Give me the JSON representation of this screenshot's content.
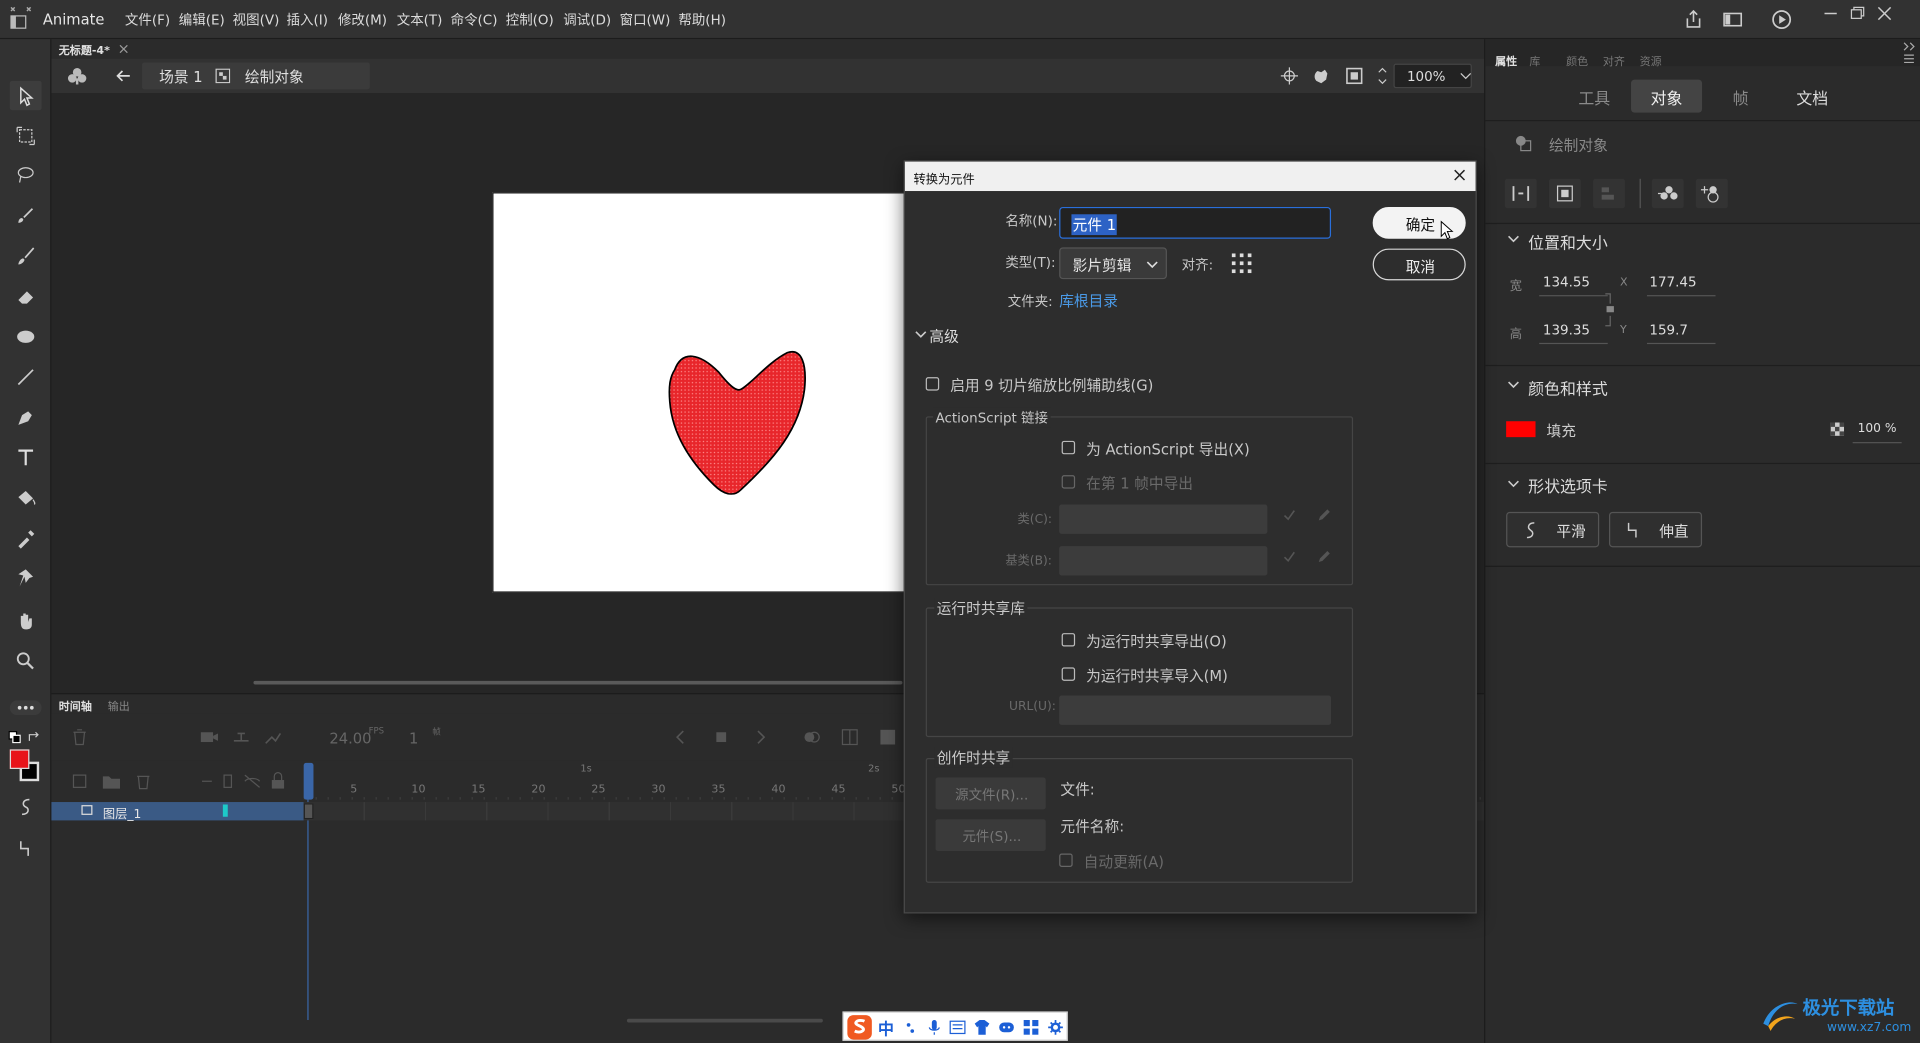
{
  "app": {
    "name": "Animate"
  },
  "menus": [
    "文件(F)",
    "编辑(E)",
    "视图(V)",
    "插入(I)",
    "修改(M)",
    "文本(T)",
    "命令(C)",
    "控制(O)",
    "调试(D)",
    "窗口(W)",
    "帮助(H)"
  ],
  "document": {
    "tab_title": "无标题-4*"
  },
  "editbar": {
    "scene": "场景 1",
    "object": "绘制对象",
    "zoom": "100%"
  },
  "timeline": {
    "tabs": [
      "时间轴",
      "输出"
    ],
    "fps": "24.00",
    "fps_unit": "FPS",
    "frame": "1",
    "frame_unit": "帧",
    "seconds": [
      "1s",
      "2s"
    ],
    "ruler": [
      "5",
      "10",
      "15",
      "20",
      "25",
      "30",
      "35",
      "40",
      "45",
      "50"
    ],
    "layer_name": "图层_1"
  },
  "rpanel": {
    "tabs": [
      "属性",
      "库",
      "颜色",
      "对齐",
      "资源"
    ],
    "subtabs": [
      "工具",
      "对象",
      "帧",
      "文档"
    ],
    "active_subtab": "对象",
    "object_type": "绘制对象",
    "position_section": "位置和大小",
    "width_label": "宽",
    "width": "134.55",
    "height_label": "高",
    "height": "139.35",
    "x_label": "X",
    "x": "177.45",
    "y_label": "Y",
    "y": "159.7",
    "color_section": "颜色和样式",
    "fill_label": "填充",
    "fill_color": "#ff0000",
    "fill_alpha": "100 %",
    "shape_section": "形状选项卡",
    "smooth": "平滑",
    "straighten": "伸直"
  },
  "dialog": {
    "title": "转换为元件",
    "name_label": "名称(N):",
    "name_value": "元件 1",
    "type_label": "类型(T):",
    "type_value": "影片剪辑",
    "align_label": "对齐:",
    "folder_label": "文件夹:",
    "folder_value": "库根目录",
    "ok": "确定",
    "cancel": "取消",
    "advanced": "高级",
    "nine_slice": "启用 9 切片缩放比例辅助线(G)",
    "as_group": "ActionScript 链接",
    "export_as": "为 ActionScript 导出(X)",
    "export_frame1": "在第 1 帧中导出",
    "class_label": "类(C):",
    "base_label": "基类(B):",
    "runtime_group": "运行时共享库",
    "runtime_export": "为运行时共享导出(O)",
    "runtime_import": "为运行时共享导入(M)",
    "url_label": "URL(U):",
    "author_group": "创作时共享",
    "source_btn": "源文件(R)...",
    "symbol_btn": "元件(S)...",
    "file_label": "文件:",
    "symbol_name_label": "元件名称:",
    "auto_update": "自动更新(A)"
  },
  "ime": {
    "label": "中"
  },
  "watermark": {
    "text": "极光下载站",
    "url": "www.xz7.com"
  },
  "colors": {
    "stroke": "#000000",
    "fill": "#e8262b",
    "accent": "#2a6fdb",
    "selection_blue": "#4a7fc0"
  }
}
